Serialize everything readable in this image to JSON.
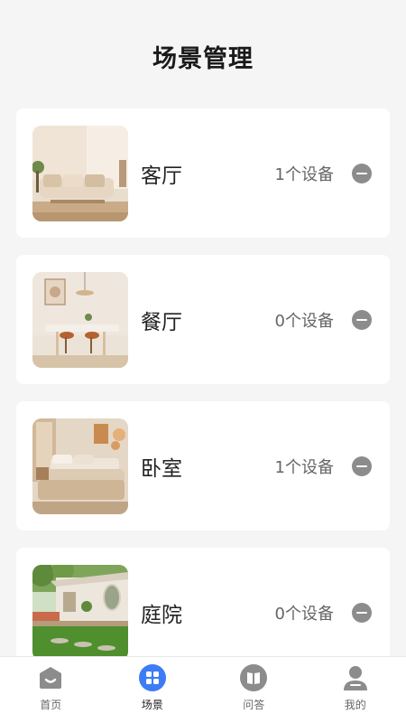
{
  "header": {
    "title": "场景管理"
  },
  "rooms": [
    {
      "name": "客厅",
      "device_count": "1个设备",
      "thumb": "living-room"
    },
    {
      "name": "餐厅",
      "device_count": "0个设备",
      "thumb": "dining-room"
    },
    {
      "name": "卧室",
      "device_count": "1个设备",
      "thumb": "bedroom"
    },
    {
      "name": "庭院",
      "device_count": "0个设备",
      "thumb": "courtyard"
    }
  ],
  "tabbar": {
    "active": "场景",
    "tabs": [
      {
        "label": "首页",
        "icon": "home-icon"
      },
      {
        "label": "场景",
        "icon": "scene-grid-icon"
      },
      {
        "label": "问答",
        "icon": "book-icon"
      },
      {
        "label": "我的",
        "icon": "person-icon"
      }
    ]
  },
  "colors": {
    "accent": "#3d7cf5",
    "icon_gray": "#8c8c8c",
    "background": "#f5f5f5"
  }
}
